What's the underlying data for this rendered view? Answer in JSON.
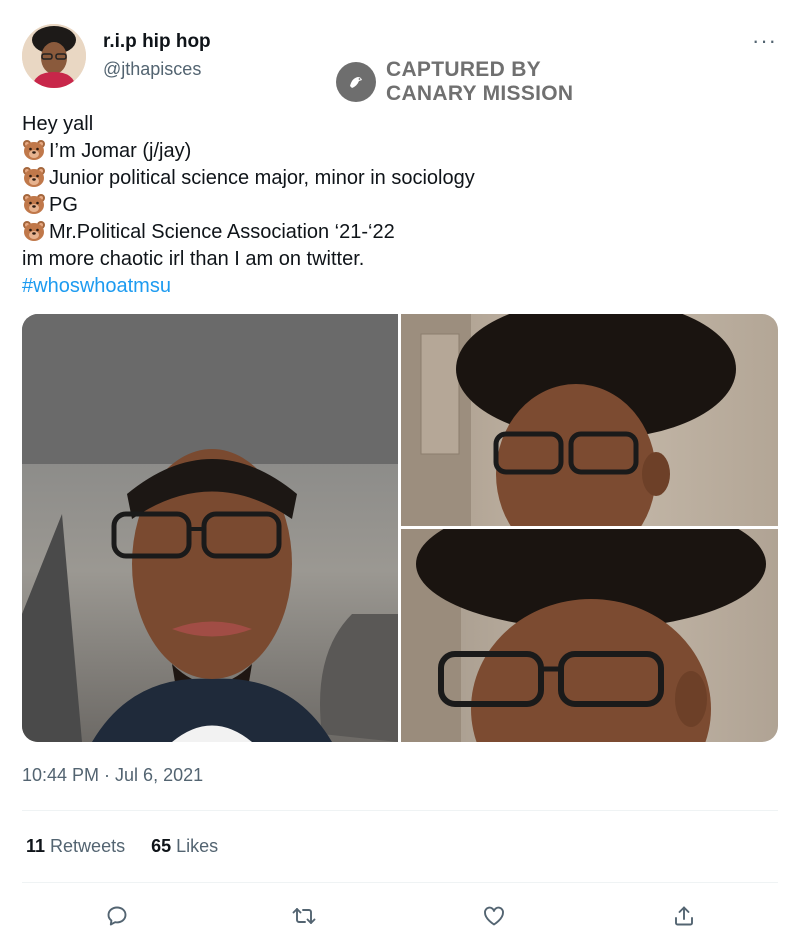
{
  "author": {
    "display_name": "r.i.p hip hop",
    "handle": "@jthapisces"
  },
  "menu": {
    "more_label": "···"
  },
  "watermark": {
    "line1": "CAPTURED BY",
    "line2": "CANARY MISSION"
  },
  "tweet": {
    "lines": [
      "Hey yall",
      "I’m Jomar (j/jay)",
      "Junior political science major, minor in sociology",
      "PG",
      "Mr.Political Science Association ‘21-‘22",
      "im more chaotic irl than I am on twitter."
    ],
    "hashtag": "#whoswhoatmsu",
    "emoji_icon": "bear-face-icon"
  },
  "timestamp": "10:44 PM · Jul 6, 2021",
  "stats": {
    "retweets_count": "11",
    "retweets_label": "Retweets",
    "likes_count": "65",
    "likes_label": "Likes"
  },
  "actions": [
    "reply-icon",
    "retweet-icon",
    "like-icon",
    "share-icon"
  ],
  "colors": {
    "link": "#1d9bf0",
    "secondary_text": "#536471",
    "primary_text": "#0f1419",
    "watermark": "#707070"
  }
}
